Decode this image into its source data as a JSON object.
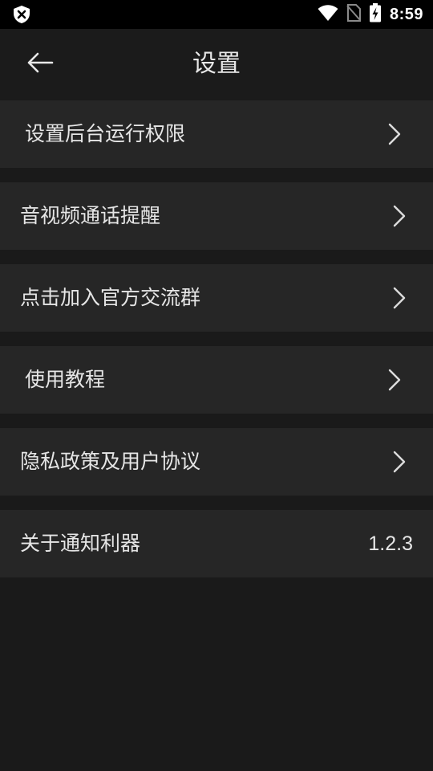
{
  "status_bar": {
    "time": "8:59",
    "icons": [
      "shield-x-icon",
      "wifi-icon",
      "no-sim-icon",
      "battery-charging-icon"
    ]
  },
  "toolbar": {
    "back_icon": "arrow-left-icon",
    "title": "设置"
  },
  "settings": {
    "items": [
      {
        "label": "设置后台运行权限",
        "icon": "chevron-right-icon"
      },
      {
        "label": "音视频通话提醒",
        "icon": "chevron-right-icon"
      },
      {
        "label": "点击加入官方交流群",
        "icon": "chevron-right-icon"
      },
      {
        "label": "使用教程",
        "icon": "chevron-right-icon"
      },
      {
        "label": "隐私政策及用户协议",
        "icon": "chevron-right-icon"
      },
      {
        "label": "关于通知利器",
        "value": "1.2.3"
      }
    ]
  },
  "colors": {
    "background": "#1a1a1a",
    "row_background": "#262626",
    "status_bar": "#000000",
    "text": "#e6e6e6"
  }
}
